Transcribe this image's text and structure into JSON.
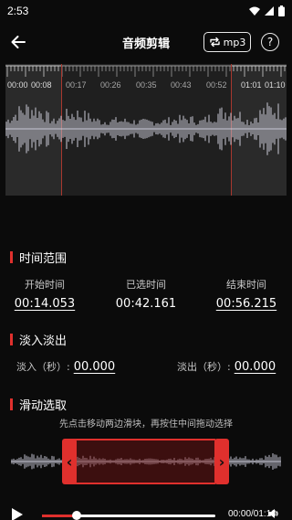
{
  "status_bar": {
    "time": "2:53"
  },
  "header": {
    "title": "音频剪辑",
    "format_button_label": "mp3",
    "help_label": "?"
  },
  "waveform": {
    "tick_labels": [
      "00:00",
      "00:08",
      "00:17",
      "00:26",
      "00:35",
      "00:43",
      "00:52",
      "01:01",
      "01:10"
    ]
  },
  "time_range": {
    "section_title": "时间范围",
    "start_label": "开始时间",
    "selected_label": "已选时间",
    "end_label": "结束时间",
    "start_value": "00:14.053",
    "selected_value": "00:42.161",
    "end_value": "00:56.215"
  },
  "fade": {
    "section_title": "淡入淡出",
    "fade_in_label": "淡入（秒）:",
    "fade_in_value": "00.000",
    "fade_out_label": "淡出（秒）:",
    "fade_out_value": "00.000"
  },
  "slide_select": {
    "section_title": "滑动选取",
    "hint": "先点击移动两边滑块，再按住中间拖动选择"
  },
  "playback": {
    "time_readout": "00:00/01:10",
    "progress_fraction": 0.0
  },
  "colors": {
    "accent": "#e0302d",
    "background": "#0b0b0b",
    "waveform_panel": "#2a2a2a"
  }
}
